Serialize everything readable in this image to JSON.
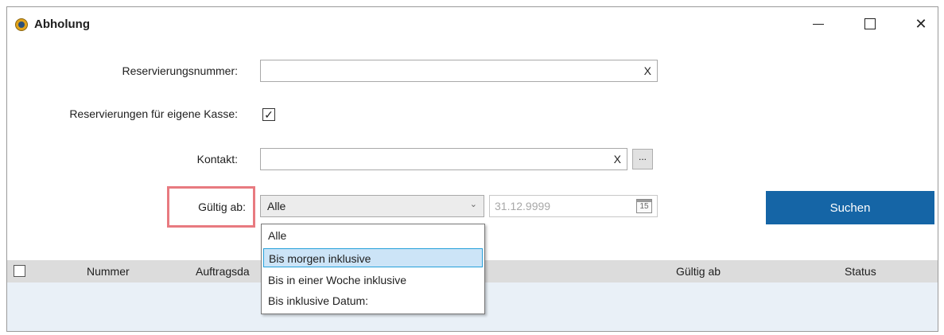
{
  "window": {
    "title": "Abholung",
    "controls": {
      "minimize": "minimize",
      "maximize": "maximize",
      "close": "✕"
    }
  },
  "form": {
    "reservation_number": {
      "label": "Reservierungsnummer:",
      "value": "",
      "clear": "X"
    },
    "own_register": {
      "label": "Reservierungen für eigene Kasse:",
      "checked": true,
      "mark": "✓"
    },
    "contact": {
      "label": "Kontakt:",
      "value": "",
      "clear": "X",
      "browse": "..."
    },
    "valid_from": {
      "label": "Gültig ab:",
      "selected": "Alle",
      "date_placeholder": "31.12.9999",
      "calendar_day": "15",
      "options": [
        "Alle",
        "Bis morgen inklusive",
        "Bis in einer Woche inklusive",
        "Bis inklusive Datum:"
      ],
      "highlighted_option": "Bis morgen inklusive"
    },
    "search_button": "Suchen"
  },
  "grid": {
    "columns": [
      "Nummer",
      "Auftragsda",
      "Gültig ab",
      "Status"
    ]
  },
  "colors": {
    "accent": "#1565a6",
    "highlight_border": "#e87a80",
    "grid_header": "#dcdcdc",
    "grid_body": "#e9f0f7",
    "dropdown_selection": "#cce4f7"
  }
}
